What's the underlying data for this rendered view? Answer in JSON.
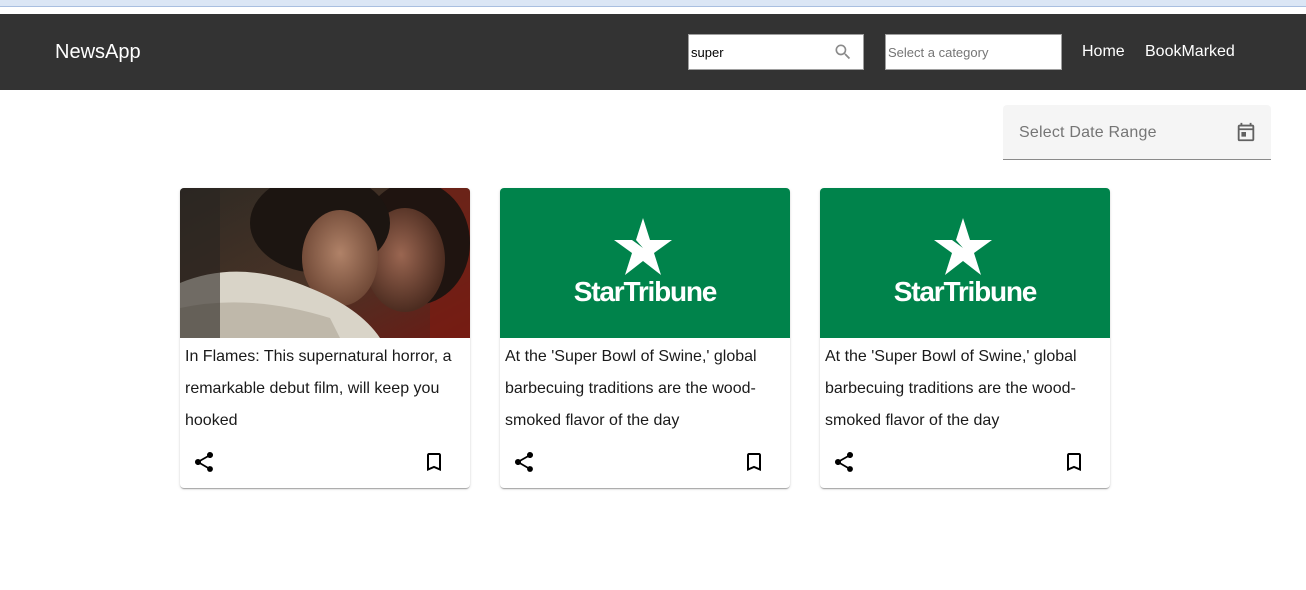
{
  "app": {
    "title": "NewsApp"
  },
  "search": {
    "value": "super",
    "icon": "search-icon"
  },
  "category": {
    "placeholder": "Select a category"
  },
  "nav": {
    "home": "Home",
    "bookmarked": "BookMarked"
  },
  "date_range": {
    "label": "Select Date Range",
    "icon": "calendar-icon"
  },
  "colors": {
    "navbar": "#333333",
    "startribune_green": "#00834b",
    "text": "#1a1a1a"
  },
  "articles": [
    {
      "title": "In Flames: This supernatural horror, a remarkable debut film, will keep you hooked",
      "image": "film-still-two-women-embracing"
    },
    {
      "title": "At the 'Super Bowl of Swine,' global barbecuing traditions are the wood-smoked flavor of the day",
      "image": "startribune-logo",
      "logo_text": "StarTribune"
    },
    {
      "title": "At the 'Super Bowl of Swine,' global barbecuing traditions are the wood-smoked flavor of the day",
      "image": "startribune-logo",
      "logo_text": "StarTribune"
    }
  ],
  "card_actions": {
    "share_icon": "share-icon",
    "bookmark_icon": "bookmark-outline-icon"
  }
}
